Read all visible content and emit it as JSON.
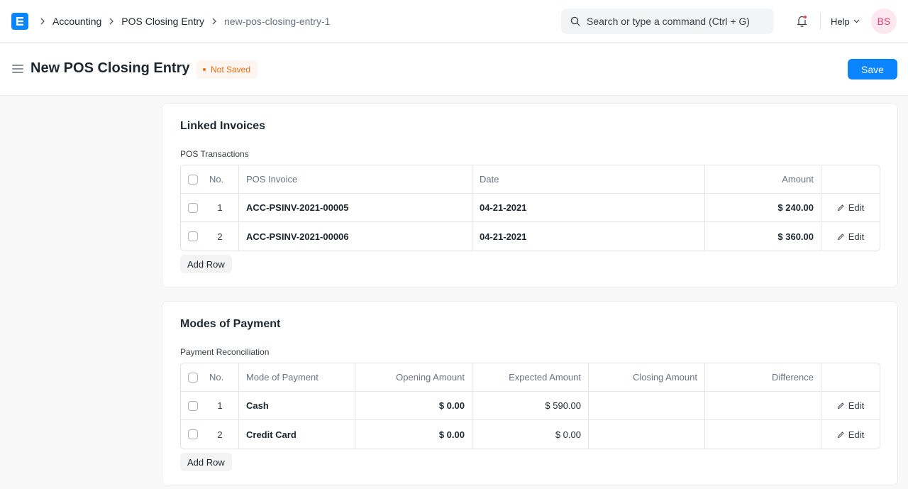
{
  "navbar": {
    "logo_letter": "E",
    "breadcrumbs": [
      "Accounting",
      "POS Closing Entry",
      "new-pos-closing-entry-1"
    ],
    "search_placeholder": "Search or type a command (Ctrl + G)",
    "help_label": "Help",
    "avatar_initials": "BS",
    "has_notification": true
  },
  "page": {
    "title": "New POS Closing Entry",
    "status_badge": "Not Saved",
    "save_label": "Save"
  },
  "linked_invoices": {
    "section_title": "Linked Invoices",
    "table_label": "POS Transactions",
    "columns": [
      "No.",
      "POS Invoice",
      "Date",
      "Amount"
    ],
    "rows": [
      {
        "no": "1",
        "pos_invoice": "ACC-PSINV-2021-00005",
        "date": "04-21-2021",
        "amount": "$ 240.00",
        "edit": "Edit"
      },
      {
        "no": "2",
        "pos_invoice": "ACC-PSINV-2021-00006",
        "date": "04-21-2021",
        "amount": "$ 360.00",
        "edit": "Edit"
      }
    ],
    "add_row_label": "Add Row"
  },
  "modes_of_payment": {
    "section_title": "Modes of Payment",
    "table_label": "Payment Reconciliation",
    "columns": [
      "No.",
      "Mode of Payment",
      "Opening Amount",
      "Expected Amount",
      "Closing Amount",
      "Difference"
    ],
    "rows": [
      {
        "no": "1",
        "mode": "Cash",
        "opening": "$ 0.00",
        "expected": "$ 590.00",
        "closing": "",
        "difference": "",
        "edit": "Edit"
      },
      {
        "no": "2",
        "mode": "Credit Card",
        "opening": "$ 0.00",
        "expected": "$ 0.00",
        "closing": "",
        "difference": "",
        "edit": "Edit"
      }
    ],
    "add_row_label": "Add Row"
  }
}
